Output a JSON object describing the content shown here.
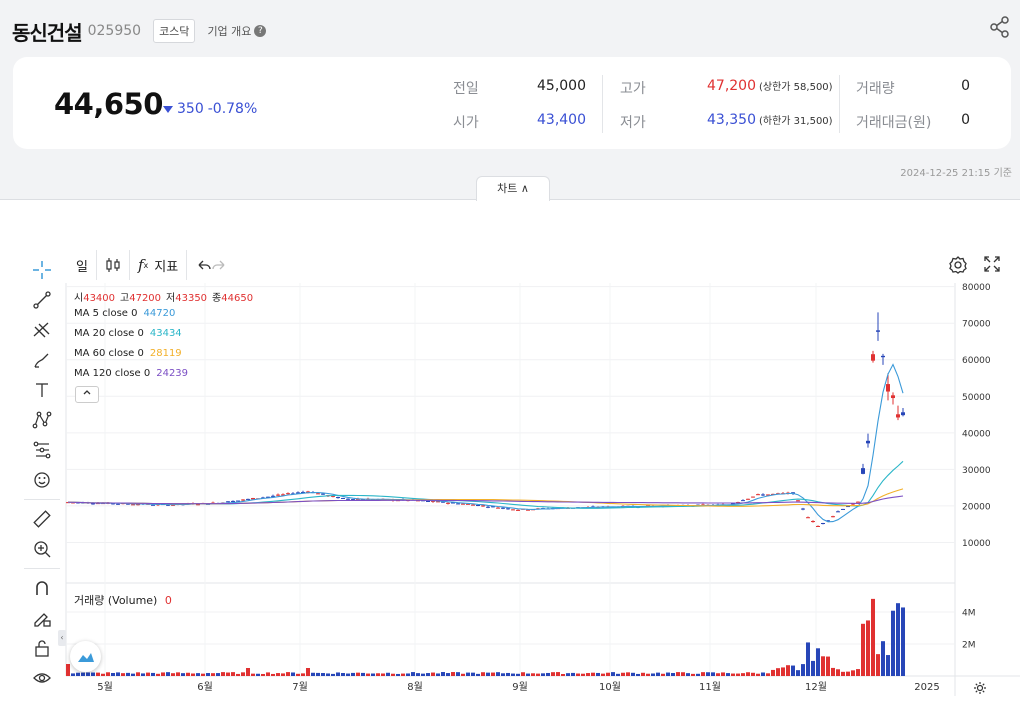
{
  "header": {
    "name": "동신건설",
    "code": "025950",
    "market": "코스닥",
    "company_link": "기업 개요",
    "help": "?"
  },
  "price": {
    "current": "44,650",
    "change": "350",
    "change_pct": "-0.78%",
    "prev_label": "전일",
    "prev": "45,000",
    "open_label": "시가",
    "open": "43,400",
    "high_label": "고가",
    "high": "47,200",
    "upper_limit": "(상한가 58,500)",
    "low_label": "저가",
    "low": "43,350",
    "lower_limit": "(하한가 31,500)",
    "volume_label": "거래량",
    "volume": "0",
    "amount_label": "거래대금(원)",
    "amount": "0"
  },
  "basis_time": "2024-12-25 21:15 기준",
  "chart_tab": "차트 ∧",
  "toolbar": {
    "period": "일",
    "indicator_fx": "f",
    "indicator_sub": "x",
    "indicator": "지표"
  },
  "legend": {
    "ohlc": [
      {
        "l": "시",
        "v": "43400"
      },
      {
        "l": "고",
        "v": "47200"
      },
      {
        "l": "저",
        "v": "43350"
      },
      {
        "l": "종",
        "v": "44650"
      }
    ],
    "ma": [
      {
        "label": "MA 5 close 0",
        "value": "44720",
        "color": "#3b9ad9"
      },
      {
        "label": "MA 20 close 0",
        "value": "43434",
        "color": "#2bb6c8"
      },
      {
        "label": "MA 60 close 0",
        "value": "28119",
        "color": "#f2b02a"
      },
      {
        "label": "MA 120 close 0",
        "value": "24239",
        "color": "#7b4fc4"
      }
    ],
    "volume_label": "거래량 (Volume)",
    "volume_value": "0"
  },
  "colors": {
    "up": "#e03131",
    "down": "#2746b8",
    "accent_blue": "#3a50d4"
  },
  "chart_data": {
    "type": "candlestick",
    "y_ticks": [
      80000,
      70000,
      60000,
      50000,
      40000,
      30000,
      20000,
      10000
    ],
    "ylim": [
      0,
      81000
    ],
    "volume_ticks": [
      "4M",
      "2M"
    ],
    "x_ticks": [
      "5월",
      "6월",
      "7월",
      "8월",
      "9월",
      "10월",
      "11월",
      "12월",
      "2025"
    ],
    "key_points": [
      {
        "period": "5월",
        "close": 21000
      },
      {
        "period": "6월",
        "close": 23000
      },
      {
        "period": "8월",
        "close": 19000
      },
      {
        "period": "10월",
        "close": 20500
      },
      {
        "period": "11월",
        "close": 23500
      },
      {
        "period": "11월 말",
        "close": 15000
      },
      {
        "period": "12월 고점",
        "high": 73500
      },
      {
        "period": "최근",
        "close": 44650
      }
    ]
  }
}
